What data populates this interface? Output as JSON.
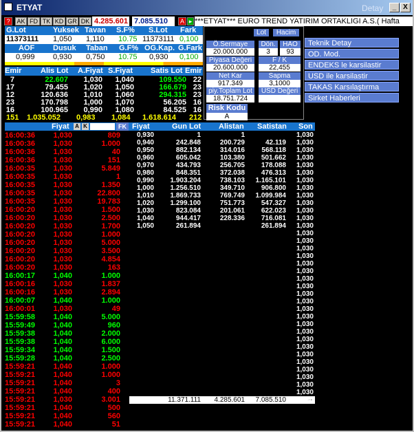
{
  "window": {
    "title": "ETYAT",
    "detail_label": "Detay",
    "min_btn": "_",
    "max_btn": "□",
    "close_btn": "X"
  },
  "toolbar": {
    "buttons": [
      "?",
      "AK",
      "FD",
      "TK",
      "KD",
      "GR",
      "DK"
    ],
    "price1": "4.285.601",
    "price2": "7.085.510",
    "a_btn": "A",
    "ticker": "***ETYAT*** EURO TREND YATIRIM ORTAKLIGI A.S.( Hafta"
  },
  "summary": {
    "row1_headers": [
      "G.Lot",
      "Yuksek",
      "Tavan",
      "S.F%",
      "S.Lot",
      "Fark"
    ],
    "row1_values": [
      "11373111",
      "1,050",
      "1,110",
      "10.75",
      "11373111",
      "0,100"
    ],
    "row2_headers": [
      "AOF",
      "Dusuk",
      "Taban",
      "G.F%",
      "OG.Kap.",
      "G.Fark"
    ],
    "row2_values": [
      "0,999",
      "0,930",
      "0,750",
      "10.75",
      "0,930",
      "0,100"
    ]
  },
  "orderbook": {
    "headers": [
      "Emir",
      "Alis Lot",
      "A.Fiyat",
      "S.Fiyat",
      "Satis Lot",
      "Emir"
    ],
    "rows": [
      [
        "7",
        "22.607",
        "1,030",
        "1,040",
        "109.550",
        "22"
      ],
      [
        "17",
        "79.455",
        "1,020",
        "1,050",
        "166.679",
        "23"
      ],
      [
        "12",
        "120.636",
        "1,010",
        "1,060",
        "294.315",
        "23"
      ],
      [
        "23",
        "170.798",
        "1,000",
        "1,070",
        "56.205",
        "16"
      ],
      [
        "16",
        "100.965",
        "0,990",
        "1,080",
        "84.525",
        "16"
      ]
    ],
    "total": [
      "151",
      "1.035.052",
      "0,983",
      "1,084",
      "1.618.614",
      "212"
    ]
  },
  "panel": {
    "lot_btn": "Lot",
    "hacim_btn": "Hacim",
    "osermaye_label": "Ö.Sermaye",
    "osermaye_val": "20.000.000",
    "don_label": "Dön.",
    "don_val": "3",
    "hao_label": "HAO",
    "hao_val": "93",
    "piyasa_label": "Piyasa Değeri",
    "piyasa_val": "20.600.000",
    "fk_label": "F / K",
    "fk_val": "22,455",
    "netkar_label": "Net Kar",
    "netkar_val": "917.349",
    "sapma_label": "Sapma",
    "sapma_val": "3,1000",
    "toplam_label": "piy.Toplam Lot",
    "toplam_val": "18.751.724",
    "usd_label": "USD Değeri",
    "usd_val": "",
    "risk_label": "Risk Kodu",
    "risk_val": "A"
  },
  "menu": {
    "items": [
      "Teknik Detay",
      "OD. Mod.",
      "ENDEKS le karsilastir",
      "USD ile karsilastir",
      "TAKAS Karsılaştırma",
      "Sirket Haberleri"
    ]
  },
  "trades": {
    "header": "Fiyat",
    "a_btn": "A",
    "k_btn": "K",
    "fk_btn": "FK",
    "rows": [
      [
        "16:00:36",
        "1,030",
        "809",
        "r"
      ],
      [
        "16:00:36",
        "1,030",
        "1.000",
        "r"
      ],
      [
        "16:00:36",
        "1,030",
        "40",
        "r"
      ],
      [
        "16:00:36",
        "1,030",
        "151",
        "r"
      ],
      [
        "16:00:35",
        "1,030",
        "5.849",
        "r"
      ],
      [
        "16:00:35",
        "1,030",
        "1",
        "r"
      ],
      [
        "16:00:35",
        "1,030",
        "1.350",
        "r"
      ],
      [
        "16:00:35",
        "1,030",
        "22.800",
        "r"
      ],
      [
        "16:00:35",
        "1,030",
        "19.783",
        "r"
      ],
      [
        "16:00:20",
        "1,030",
        "1.500",
        "r"
      ],
      [
        "16:00:20",
        "1,030",
        "2.500",
        "r"
      ],
      [
        "16:00:20",
        "1,030",
        "1.700",
        "r"
      ],
      [
        "16:00:20",
        "1,030",
        "1.000",
        "r"
      ],
      [
        "16:00:20",
        "1,030",
        "5.000",
        "r"
      ],
      [
        "16:00:20",
        "1,030",
        "3.500",
        "r"
      ],
      [
        "16:00:20",
        "1,030",
        "4.854",
        "r"
      ],
      [
        "16:00:20",
        "1,030",
        "163",
        "r"
      ],
      [
        "16:00:17",
        "1,040",
        "1.000",
        "g"
      ],
      [
        "16:00:16",
        "1,030",
        "1.837",
        "r"
      ],
      [
        "16:00:16",
        "1,030",
        "2.894",
        "r"
      ],
      [
        "16:00:07",
        "1,040",
        "1.000",
        "g"
      ],
      [
        "16:00:01",
        "1,030",
        "49",
        "r"
      ],
      [
        "15:59:58",
        "1,040",
        "5.000",
        "g"
      ],
      [
        "15:59:49",
        "1,040",
        "960",
        "g"
      ],
      [
        "15:59:38",
        "1,040",
        "2.000",
        "g"
      ],
      [
        "15:59:38",
        "1,040",
        "6.000",
        "g"
      ],
      [
        "15:59:34",
        "1,040",
        "1.500",
        "g"
      ],
      [
        "15:59:28",
        "1,040",
        "2.500",
        "g"
      ],
      [
        "15:59:21",
        "1,040",
        "1.000",
        "r"
      ],
      [
        "15:59:21",
        "1,040",
        "1.000",
        "r"
      ],
      [
        "15:59:21",
        "1,040",
        "3",
        "r"
      ],
      [
        "15:59:21",
        "1,040",
        "400",
        "r"
      ],
      [
        "15:59:21",
        "1,030",
        "3.001",
        "r"
      ],
      [
        "15:59:21",
        "1,040",
        "500",
        "r"
      ],
      [
        "15:59:21",
        "1,040",
        "560",
        "r"
      ],
      [
        "15:59:21",
        "1,040",
        "51",
        "r"
      ]
    ]
  },
  "depth": {
    "headers": [
      "Fiyat",
      "Gun Lot",
      "Alistan",
      "Satistan",
      "Son"
    ],
    "rows": [
      [
        "0,930",
        "1",
        "1",
        "",
        ""
      ],
      [
        "0,940",
        "242.848",
        "200.729",
        "42.119",
        ""
      ],
      [
        "0,950",
        "882.134",
        "314.016",
        "568.118",
        ""
      ],
      [
        "0,960",
        "605.042",
        "103.380",
        "501.662",
        ""
      ],
      [
        "0,970",
        "434.793",
        "256.705",
        "178.088",
        ""
      ],
      [
        "0,980",
        "848.351",
        "372.038",
        "476.313",
        ""
      ],
      [
        "0,990",
        "1.903.204",
        "738.103",
        "1.165.101",
        ""
      ],
      [
        "1,000",
        "1.256.510",
        "349.710",
        "906.800",
        ""
      ],
      [
        "1,010",
        "1.869.733",
        "769.749",
        "1.099.984",
        ""
      ],
      [
        "1,020",
        "1.299.100",
        "751.773",
        "547.327",
        ""
      ],
      [
        "1,030",
        "823.084",
        "201.061",
        "622.023",
        ""
      ],
      [
        "1,040",
        "944.417",
        "228.336",
        "716.081",
        ""
      ],
      [
        "1,050",
        "261.894",
        "",
        "261.894",
        ""
      ]
    ],
    "son_values": [
      "1,030",
      "1,030",
      "1,030",
      "1,030",
      "1,030",
      "1,030",
      "1,030",
      "1,030",
      "1,030",
      "1,030",
      "1,030",
      "1,030",
      "1,030",
      "1,030",
      "1,030",
      "1,030",
      "1,030",
      "1,030",
      "1,030",
      "1,030",
      "1,030",
      "1,030",
      "1,030",
      "1,030",
      "1,030",
      "1,030",
      "1,030",
      "1,030",
      "1,030",
      "1,030",
      "1,030",
      "1,030",
      "1,030",
      "1,030",
      "1,030",
      "1,030"
    ],
    "total": [
      "11.371.111",
      "4.285.601",
      "7.085.510",
      "--"
    ]
  }
}
